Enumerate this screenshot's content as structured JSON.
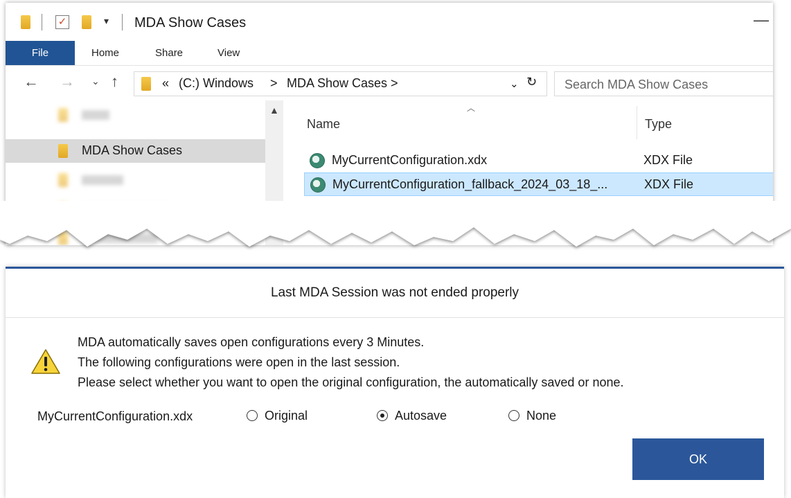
{
  "explorer": {
    "window_title": "MDA Show Cases",
    "ribbon_tabs": [
      "File",
      "Home",
      "Share",
      "View"
    ],
    "breadcrumb": {
      "overflow": "«",
      "items": [
        "(C:) Windows",
        "MDA Show Cases"
      ],
      "separator": ">"
    },
    "search_placeholder": "Search MDA Show Cases",
    "nav_items": [
      {
        "label": "",
        "blurred": true
      },
      {
        "label": "MDA Show Cases",
        "blurred": false,
        "selected": true
      },
      {
        "label": "",
        "blurred": true
      },
      {
        "label": "",
        "blurred": true
      },
      {
        "label": "",
        "blurred": true
      }
    ],
    "columns": {
      "name": "Name",
      "type": "Type"
    },
    "files": [
      {
        "name": "MyCurrentConfiguration.xdx",
        "type": "XDX File",
        "selected": false
      },
      {
        "name": "MyCurrentConfiguration_fallback_2024_03_18_...",
        "type": "XDX File",
        "selected": true
      }
    ]
  },
  "dialog": {
    "title": "Last MDA Session was not ended properly",
    "messages": [
      "MDA automatically saves open configurations every 3 Minutes.",
      "The following configurations were open in the last session.",
      "Please select whether you want to open the original configuration, the automatically saved or none."
    ],
    "config_name": "MyCurrentConfiguration.xdx",
    "options": [
      {
        "label": "Original",
        "checked": false
      },
      {
        "label": "Autosave",
        "checked": true
      },
      {
        "label": "None",
        "checked": false
      }
    ],
    "ok_label": "OK"
  },
  "colors": {
    "accent": "#2b579a",
    "file_tab": "#215494",
    "selection": "#cce8ff",
    "nav_selected": "#d9d9d9"
  }
}
